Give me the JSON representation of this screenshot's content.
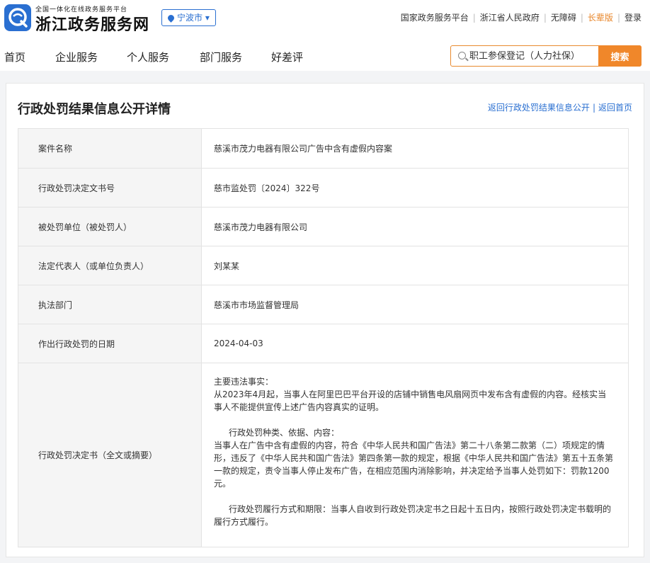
{
  "header": {
    "logo_sub": "全国一体化在线政务服务平台",
    "logo_main": "浙江政务服务网",
    "city": "宁波市",
    "top_links": [
      "国家政务服务平台",
      "浙江省人民政府",
      "无障碍",
      "长辈版",
      "登录"
    ]
  },
  "nav": [
    "首页",
    "企业服务",
    "个人服务",
    "部门服务",
    "好差评"
  ],
  "search": {
    "placeholder": "职工参保登记（人力社保）",
    "button": "搜索"
  },
  "page": {
    "title": "行政处罚结果信息公开详情",
    "link_back_list": "返回行政处罚结果信息公开",
    "link_home": "返回首页"
  },
  "rows": [
    {
      "label": "案件名称",
      "value": "慈溪市茂力电器有限公司广告中含有虚假内容案"
    },
    {
      "label": "行政处罚决定文书号",
      "value": "慈市监处罚〔2024〕322号"
    },
    {
      "label": "被处罚单位（被处罚人）",
      "value": "慈溪市茂力电器有限公司"
    },
    {
      "label": "法定代表人（或单位负责人）",
      "value": "刘某某"
    },
    {
      "label": "执法部门",
      "value": "慈溪市市场监督管理局"
    },
    {
      "label": "作出行政处罚的日期",
      "value": "2024-04-03"
    }
  ],
  "decision": {
    "label": "行政处罚决定书（全文或摘要）",
    "facts_title": "主要违法事实：",
    "facts": "从2023年4月起，当事人在阿里巴巴平台开设的店铺中销售电风扇网页中发布含有虚假的内容。经核实当事人不能提供宣传上述广告内容真实的证明。",
    "type_title": "行政处罚种类、依据、内容：",
    "type": "当事人在广告中含有虚假的内容，符合《中华人民共和国广告法》第二十八条第二款第（二）项规定的情形，违反了《中华人民共和国广告法》第四条第一款的规定，根据《中华人民共和国广告法》第五十五条第一款的规定，责令当事人停止发布广告，在相应范围内消除影响，并决定给予当事人处罚如下：罚款1200元。",
    "term": "行政处罚履行方式和期限：当事人自收到行政处罚决定书之日起十五日内，按照行政处罚决定书载明的履行方式履行。"
  }
}
